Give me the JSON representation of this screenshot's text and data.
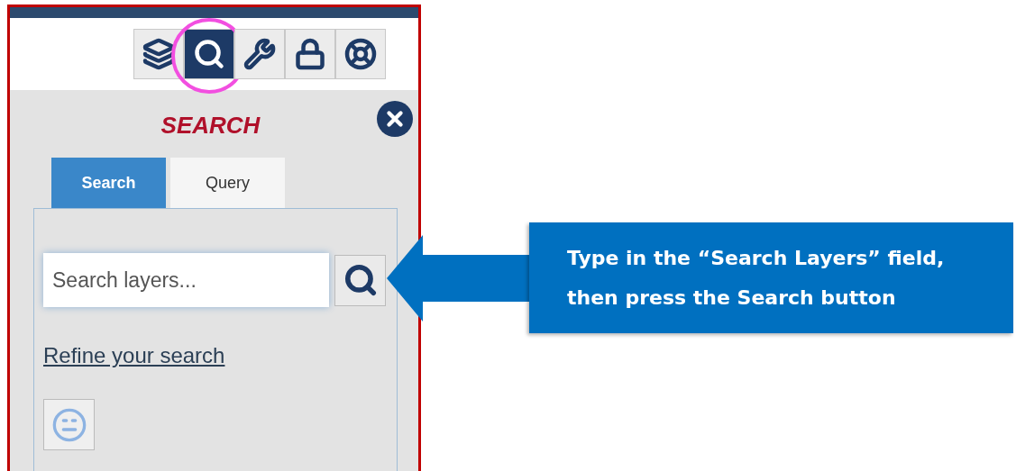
{
  "toolbar": {
    "buttons": [
      {
        "kind": "layers",
        "selected": false
      },
      {
        "kind": "search",
        "selected": true
      },
      {
        "kind": "tools",
        "selected": false
      },
      {
        "kind": "lock",
        "selected": false
      },
      {
        "kind": "help",
        "selected": false
      }
    ]
  },
  "panel": {
    "title": "SEARCH",
    "tabs": [
      {
        "label": "Search",
        "selected": true
      },
      {
        "label": "Query",
        "selected": false
      }
    ],
    "search_field": {
      "placeholder": "Search layers..."
    },
    "link": "Refine your search"
  },
  "callout": {
    "lines": [
      "Type in the “Search Layers” field,",
      "then press the Search button"
    ]
  }
}
